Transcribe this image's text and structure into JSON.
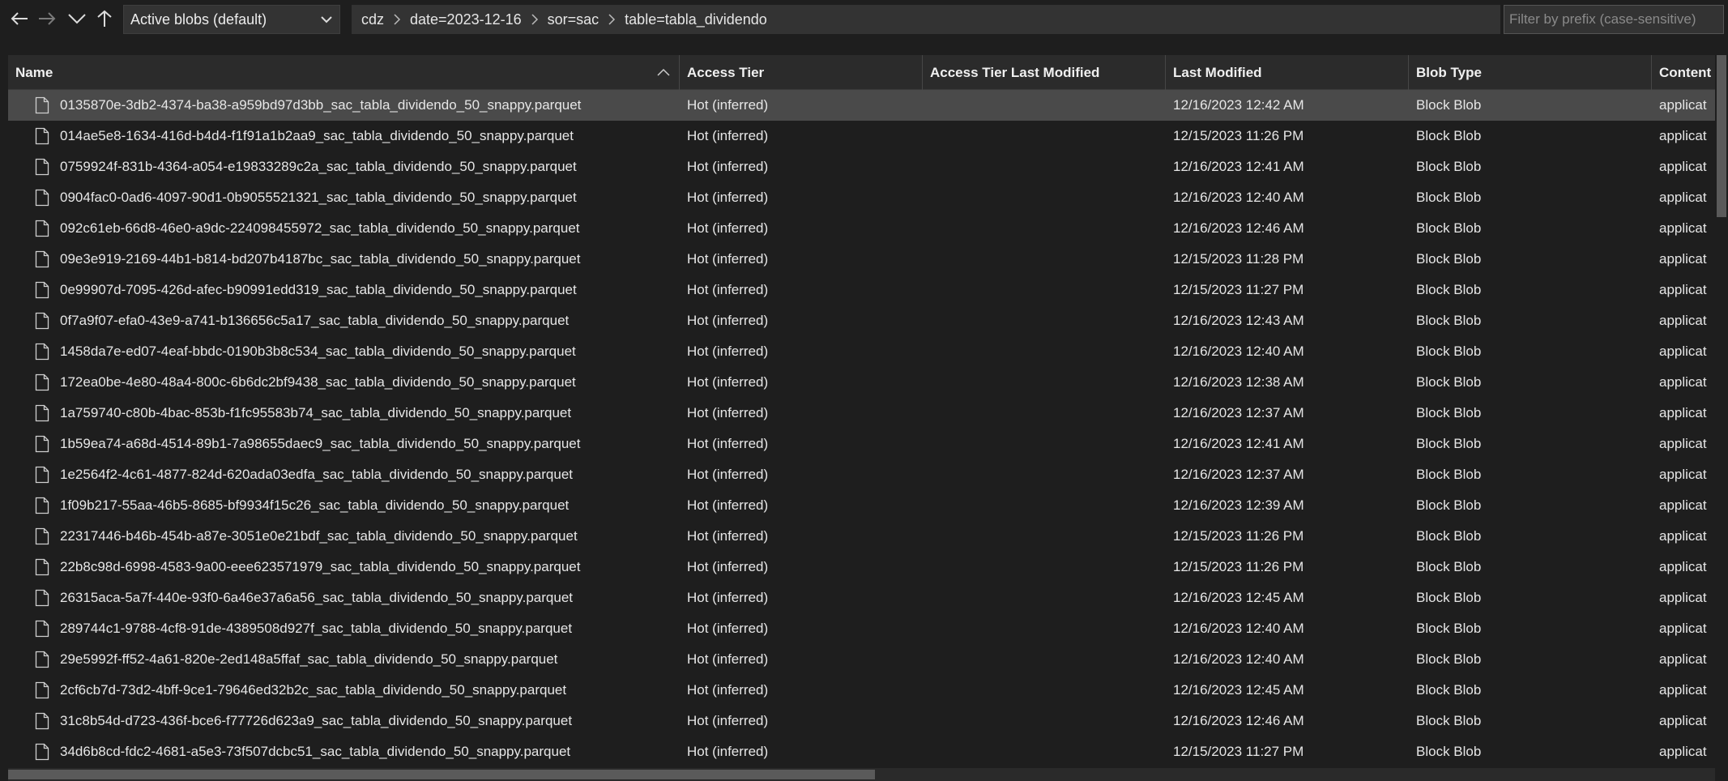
{
  "toolbar": {
    "back_icon": "arrow-left-icon",
    "forward_icon": "arrow-right-icon",
    "expand_icon": "chevron-down-icon",
    "up_icon": "arrow-up-icon",
    "view_dropdown": "Active blobs (default)",
    "filter_placeholder": "Filter by prefix (case-sensitive)"
  },
  "breadcrumb": [
    "cdz",
    "date=2023-12-16",
    "sor=sac",
    "table=tabla_dividendo"
  ],
  "columns": [
    "Name",
    "Access Tier",
    "Access Tier Last Modified",
    "Last Modified",
    "Blob Type",
    "Content"
  ],
  "sort": {
    "column": "Name",
    "direction": "ascending"
  },
  "rows": [
    {
      "name": "0135870e-3db2-4374-ba38-a959bd97d3bb_sac_tabla_dividendo_50_snappy.parquet",
      "tier": "Hot (inferred)",
      "tier_modified": "",
      "modified": "12/16/2023 12:42 AM",
      "type": "Block Blob",
      "content": "applicat",
      "selected": true
    },
    {
      "name": "014ae5e8-1634-416d-b4d4-f1f91a1b2aa9_sac_tabla_dividendo_50_snappy.parquet",
      "tier": "Hot (inferred)",
      "tier_modified": "",
      "modified": "12/15/2023 11:26 PM",
      "type": "Block Blob",
      "content": "applicat"
    },
    {
      "name": "0759924f-831b-4364-a054-e19833289c2a_sac_tabla_dividendo_50_snappy.parquet",
      "tier": "Hot (inferred)",
      "tier_modified": "",
      "modified": "12/16/2023 12:41 AM",
      "type": "Block Blob",
      "content": "applicat"
    },
    {
      "name": "0904fac0-0ad6-4097-90d1-0b9055521321_sac_tabla_dividendo_50_snappy.parquet",
      "tier": "Hot (inferred)",
      "tier_modified": "",
      "modified": "12/16/2023 12:40 AM",
      "type": "Block Blob",
      "content": "applicat"
    },
    {
      "name": "092c61eb-66d8-46e0-a9dc-224098455972_sac_tabla_dividendo_50_snappy.parquet",
      "tier": "Hot (inferred)",
      "tier_modified": "",
      "modified": "12/16/2023 12:46 AM",
      "type": "Block Blob",
      "content": "applicat"
    },
    {
      "name": "09e3e919-2169-44b1-b814-bd207b4187bc_sac_tabla_dividendo_50_snappy.parquet",
      "tier": "Hot (inferred)",
      "tier_modified": "",
      "modified": "12/15/2023 11:28 PM",
      "type": "Block Blob",
      "content": "applicat"
    },
    {
      "name": "0e99907d-7095-426d-afec-b90991edd319_sac_tabla_dividendo_50_snappy.parquet",
      "tier": "Hot (inferred)",
      "tier_modified": "",
      "modified": "12/15/2023 11:27 PM",
      "type": "Block Blob",
      "content": "applicat"
    },
    {
      "name": "0f7a9f07-efa0-43e9-a741-b136656c5a17_sac_tabla_dividendo_50_snappy.parquet",
      "tier": "Hot (inferred)",
      "tier_modified": "",
      "modified": "12/16/2023 12:43 AM",
      "type": "Block Blob",
      "content": "applicat"
    },
    {
      "name": "1458da7e-ed07-4eaf-bbdc-0190b3b8c534_sac_tabla_dividendo_50_snappy.parquet",
      "tier": "Hot (inferred)",
      "tier_modified": "",
      "modified": "12/16/2023 12:40 AM",
      "type": "Block Blob",
      "content": "applicat"
    },
    {
      "name": "172ea0be-4e80-48a4-800c-6b6dc2bf9438_sac_tabla_dividendo_50_snappy.parquet",
      "tier": "Hot (inferred)",
      "tier_modified": "",
      "modified": "12/16/2023 12:38 AM",
      "type": "Block Blob",
      "content": "applicat"
    },
    {
      "name": "1a759740-c80b-4bac-853b-f1fc95583b74_sac_tabla_dividendo_50_snappy.parquet",
      "tier": "Hot (inferred)",
      "tier_modified": "",
      "modified": "12/16/2023 12:37 AM",
      "type": "Block Blob",
      "content": "applicat"
    },
    {
      "name": "1b59ea74-a68d-4514-89b1-7a98655daec9_sac_tabla_dividendo_50_snappy.parquet",
      "tier": "Hot (inferred)",
      "tier_modified": "",
      "modified": "12/16/2023 12:41 AM",
      "type": "Block Blob",
      "content": "applicat"
    },
    {
      "name": "1e2564f2-4c61-4877-824d-620ada03edfa_sac_tabla_dividendo_50_snappy.parquet",
      "tier": "Hot (inferred)",
      "tier_modified": "",
      "modified": "12/16/2023 12:37 AM",
      "type": "Block Blob",
      "content": "applicat"
    },
    {
      "name": "1f09b217-55aa-46b5-8685-bf9934f15c26_sac_tabla_dividendo_50_snappy.parquet",
      "tier": "Hot (inferred)",
      "tier_modified": "",
      "modified": "12/16/2023 12:39 AM",
      "type": "Block Blob",
      "content": "applicat"
    },
    {
      "name": "22317446-b46b-454b-a87e-3051e0e21bdf_sac_tabla_dividendo_50_snappy.parquet",
      "tier": "Hot (inferred)",
      "tier_modified": "",
      "modified": "12/15/2023 11:26 PM",
      "type": "Block Blob",
      "content": "applicat"
    },
    {
      "name": "22b8c98d-6998-4583-9a00-eee623571979_sac_tabla_dividendo_50_snappy.parquet",
      "tier": "Hot (inferred)",
      "tier_modified": "",
      "modified": "12/15/2023 11:26 PM",
      "type": "Block Blob",
      "content": "applicat"
    },
    {
      "name": "26315aca-5a7f-440e-93f0-6a46e37a6a56_sac_tabla_dividendo_50_snappy.parquet",
      "tier": "Hot (inferred)",
      "tier_modified": "",
      "modified": "12/16/2023 12:45 AM",
      "type": "Block Blob",
      "content": "applicat"
    },
    {
      "name": "289744c1-9788-4cf8-91de-4389508d927f_sac_tabla_dividendo_50_snappy.parquet",
      "tier": "Hot (inferred)",
      "tier_modified": "",
      "modified": "12/16/2023 12:40 AM",
      "type": "Block Blob",
      "content": "applicat"
    },
    {
      "name": "29e5992f-ff52-4a61-820e-2ed148a5ffaf_sac_tabla_dividendo_50_snappy.parquet",
      "tier": "Hot (inferred)",
      "tier_modified": "",
      "modified": "12/16/2023 12:40 AM",
      "type": "Block Blob",
      "content": "applicat"
    },
    {
      "name": "2cf6cb7d-73d2-4bff-9ce1-79646ed32b2c_sac_tabla_dividendo_50_snappy.parquet",
      "tier": "Hot (inferred)",
      "tier_modified": "",
      "modified": "12/16/2023 12:45 AM",
      "type": "Block Blob",
      "content": "applicat"
    },
    {
      "name": "31c8b54d-d723-436f-bce6-f77726d623a9_sac_tabla_dividendo_50_snappy.parquet",
      "tier": "Hot (inferred)",
      "tier_modified": "",
      "modified": "12/16/2023 12:46 AM",
      "type": "Block Blob",
      "content": "applicat"
    },
    {
      "name": "34d6b8cd-fdc2-4681-a5e3-73f507dcbc51_sac_tabla_dividendo_50_snappy.parquet",
      "tier": "Hot (inferred)",
      "tier_modified": "",
      "modified": "12/15/2023 11:27 PM",
      "type": "Block Blob",
      "content": "applicat"
    }
  ]
}
